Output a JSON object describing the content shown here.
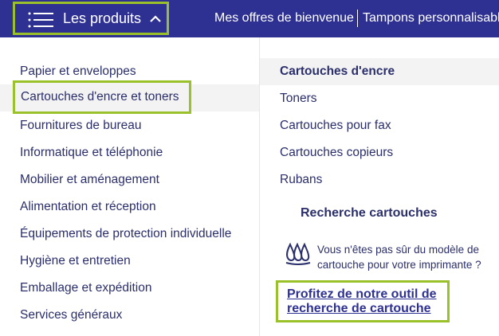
{
  "topbar": {
    "products_label": "Les produits",
    "nav_links": [
      "Mes offres de bienvenue",
      "Tampons personnalisables"
    ]
  },
  "left_menu": {
    "items": [
      "Papier et enveloppes",
      "Cartouches d'encre et toners",
      "Fournitures de bureau",
      "Informatique et téléphonie",
      "Mobilier et aménagement",
      "Alimentation et réception",
      "Équipements de protection individuelle",
      "Hygiène et entretien",
      "Emballage et expédition",
      "Services généraux"
    ]
  },
  "right_menu": {
    "items": [
      "Cartouches d'encre",
      "Toners",
      "Cartouches pour fax",
      "Cartouches copieurs",
      "Rubans"
    ],
    "search_heading": "Recherche cartouches",
    "help_text": "Vous n'êtes pas sûr du modèle de cartouche pour votre imprimante ?",
    "tool_link": "Profitez de notre outil de recherche de cartouche"
  },
  "colors": {
    "nav_bg": "#2e3192",
    "highlight_border": "#9ac02a",
    "text": "#2b2f6b"
  }
}
